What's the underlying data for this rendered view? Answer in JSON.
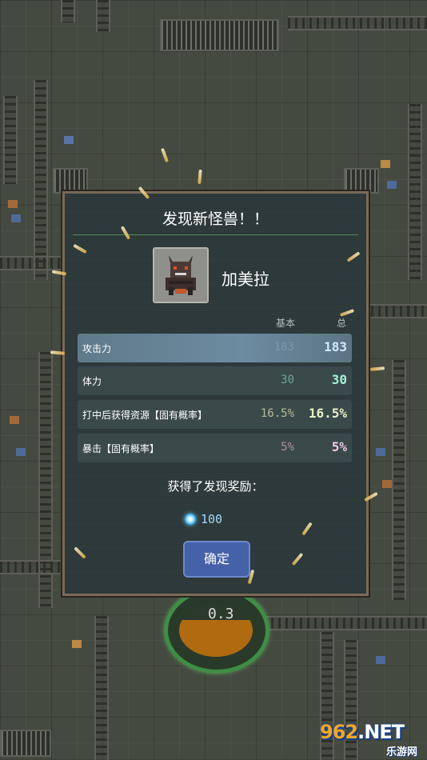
{
  "dialog": {
    "title": "发现新怪兽！！",
    "monster_name": "加美拉",
    "columns": {
      "base": "基本",
      "total": "总"
    },
    "stats": [
      {
        "label": "攻击力",
        "base": "183",
        "total": "183",
        "color": "#cfe8ff",
        "selected": true
      },
      {
        "label": "体力",
        "base": "30",
        "total": "30",
        "color": "#a6f0d6",
        "selected": false
      },
      {
        "label": "打中后获得资源【固有概率】",
        "base": "16.5%",
        "total": "16.5%",
        "color": "#e9f2c7",
        "selected": false
      },
      {
        "label": "暴击【固有概率】",
        "base": "5%",
        "total": "5%",
        "color": "#f0c7e6",
        "selected": false
      }
    ],
    "reward_title": "获得了发现奖励：",
    "reward": {
      "icon": "gem-icon",
      "amount": "100"
    },
    "confirm_label": "确定"
  },
  "gauge": {
    "reading": "0.3"
  },
  "watermark": {
    "brand_main": "962",
    "brand_suffix": ".NET",
    "brand_sub": "乐游网"
  }
}
